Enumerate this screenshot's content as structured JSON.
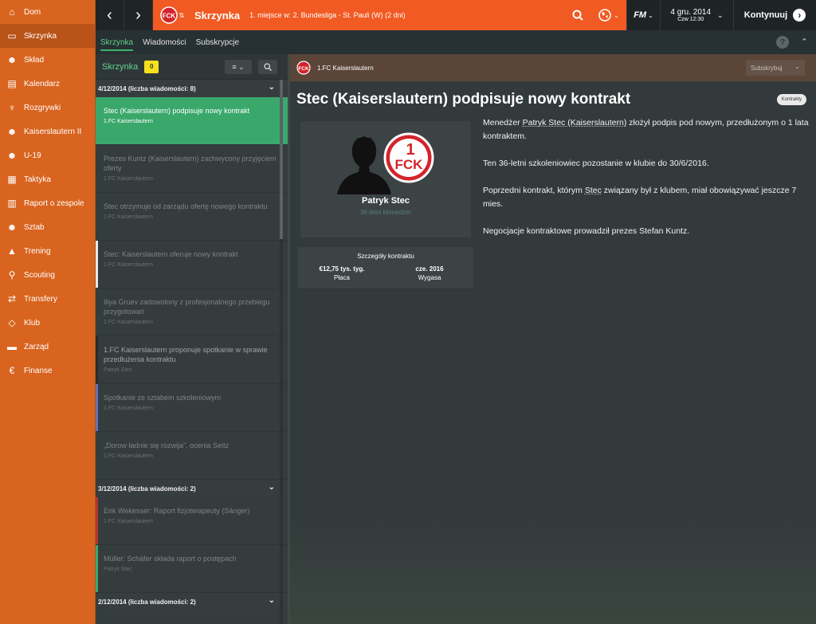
{
  "sidebar": {
    "items": [
      {
        "label": "Dom",
        "icon": "home-icon"
      },
      {
        "label": "Skrzynka",
        "icon": "inbox-icon",
        "active": true
      },
      {
        "label": "Skład",
        "icon": "squad-icon"
      },
      {
        "label": "Kalendarz",
        "icon": "calendar-icon"
      },
      {
        "label": "Rozgrywki",
        "icon": "trophy-icon"
      },
      {
        "label": "Kaiserslautern II",
        "icon": "team-icon"
      },
      {
        "label": "U-19",
        "icon": "youth-team-icon"
      },
      {
        "label": "Taktyka",
        "icon": "tactics-icon"
      },
      {
        "label": "Raport o zespole",
        "icon": "report-icon"
      },
      {
        "label": "Sztab",
        "icon": "staff-icon"
      },
      {
        "label": "Trening",
        "icon": "training-icon"
      },
      {
        "label": "Scouting",
        "icon": "scouting-icon"
      },
      {
        "label": "Transfery",
        "icon": "transfers-icon"
      },
      {
        "label": "Klub",
        "icon": "club-icon"
      },
      {
        "label": "Zarząd",
        "icon": "board-icon"
      },
      {
        "label": "Finanse",
        "icon": "finances-icon"
      }
    ]
  },
  "topbar": {
    "title": "Skrzynka",
    "subtitle": "1. miejsce w: 2. Bundesliga - St. Pauli (W) (2 dni)",
    "date": "4 gru. 2014",
    "time": "Czw 12:30",
    "continue_label": "Kontynuuj",
    "fm_label": "FM"
  },
  "tabs": [
    "Skrzynka",
    "Wiadomości",
    "Subskrypcje"
  ],
  "help_label": "?",
  "inbox": {
    "title": "Skrzynka",
    "count": "0",
    "groups": [
      {
        "label": "4/12/2014 (liczba wiadomości: 8)",
        "messages": [
          {
            "title": "Stec (Kaiserslautern) podpisuje nowy kontrakt",
            "sender": "1.FC Kaiserslautern",
            "selected": true,
            "bar": "#3aa86b"
          },
          {
            "title": "Prezes Kuntz (Kaiserslautern) zachwycony przyjęciem oferty",
            "sender": "1.FC Kaiserslautern",
            "bar": ""
          },
          {
            "title": "Stec otrzymuje od zarządu ofertę nowego kontraktu",
            "sender": "1.FC Kaiserslautern",
            "bar": ""
          },
          {
            "title": "Stec: Kaiserslautern oferuje nowy kontrakt",
            "sender": "1.FC Kaiserslautern",
            "bar": "#e8e8e8"
          },
          {
            "title": "Iliya Gruev zadowolony z profesjonalnego przebiegu przygotowań",
            "sender": "1.FC Kaiserslautern",
            "bar": ""
          },
          {
            "title": "1.FC Kaiserslautern proponuje spotkanie w sprawie przedłużenia kontraktu",
            "sender": "Patryk Stec",
            "bar": "#2a2a2a",
            "unread": true
          },
          {
            "title": "Spotkanie ze sztabem szkoleniowym",
            "sender": "1.FC Kaiserslautern",
            "bar": "#6b6fb8"
          },
          {
            "title": "„Dorow ładnie się rozwija”, ocenia Seitz",
            "sender": "1.FC Kaiserslautern",
            "bar": ""
          }
        ]
      },
      {
        "label": "3/12/2014 (liczba wiadomości: 2)",
        "messages": [
          {
            "title": "Erik Wekesser: Raport fizjoterapeuty (Sänger)",
            "sender": "1.FC Kaiserslautern",
            "bar": "#b2352f"
          },
          {
            "title": "Müller: Schäfer składa raport o postępach",
            "sender": "Patryk Stec",
            "bar": "#3aa86b"
          }
        ]
      },
      {
        "label": "2/12/2014 (liczba wiadomości: 2)",
        "messages": []
      }
    ]
  },
  "article": {
    "club": "1.FC Kaiserslautern",
    "subscribe_label": "Subskrybuj",
    "headline": "Stec (Kaiserslautern) podpisuje nowy kontrakt",
    "tag": "Kontrakty",
    "person_name": "Patryk Stec",
    "person_role": "36-letni Menedżer",
    "paragraph1_before": "Menedżer ",
    "paragraph1_link": "Patryk Stec (Kaiserslautern)",
    "paragraph1_after": " złożył podpis pod nowym, przedłużonym o 1 lata kontraktem.",
    "paragraph2": "Ten 36-letni szkoleniowiec pozostanie w klubie do 30/6/2016.",
    "paragraph3_before": "Poprzedni kontrakt, którym ",
    "paragraph3_link": "Stec",
    "paragraph3_after": " związany był z klubem, miał obowiązywać jeszcze 7 mies.",
    "paragraph4": "Negocjacje kontraktowe prowadził prezes Stefan Kuntz.",
    "contract": {
      "title": "Szczegóły kontraktu",
      "wage_value": "€12,75 tys. tyg.",
      "wage_label": "Płaca",
      "expiry_value": "cze. 2016",
      "expiry_label": "Wygasa"
    }
  },
  "colors": {
    "sidebar": "#d9641f",
    "topbar": "#f15a22",
    "selected": "#3aa86b",
    "count_badge": "#f5e11c",
    "club_red": "#d3242b"
  }
}
